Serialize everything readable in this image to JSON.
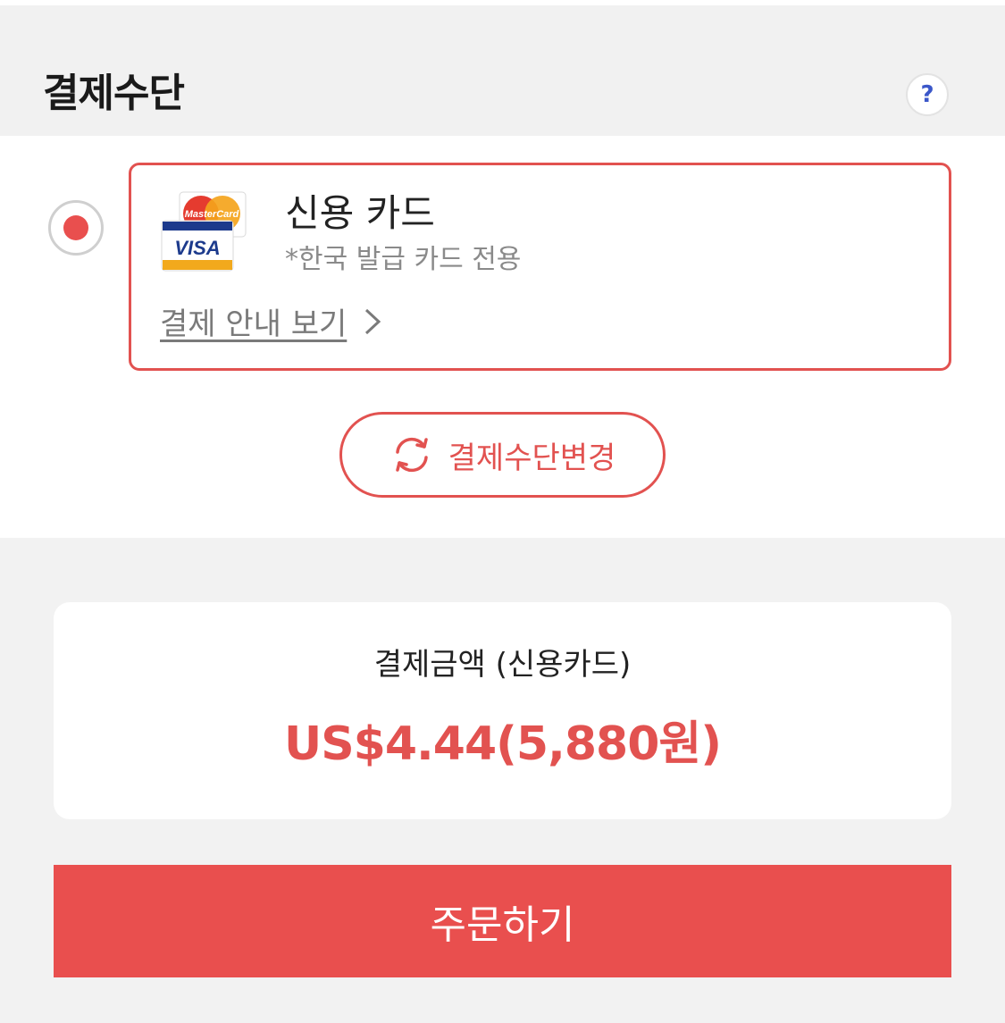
{
  "header": {
    "title": "결제수단",
    "help_label": "?"
  },
  "payment_option": {
    "selected": true,
    "name": "신용 카드",
    "note": "*한국 발급 카드 전용",
    "guide_link": "결제 안내 보기",
    "logo_text_top": "MasterCard",
    "logo_text_bottom": "VISA"
  },
  "change_button": {
    "label": "결제수단변경",
    "icon": "refresh-icon"
  },
  "amount": {
    "label": "결제금액 (신용카드)",
    "value": "US$4.44(5,880원)"
  },
  "order_button": {
    "label": "주문하기"
  },
  "colors": {
    "accent": "#e94f4e",
    "border_accent": "#e25250",
    "help_icon": "#3b57c9",
    "background": "#f2f2f2"
  }
}
